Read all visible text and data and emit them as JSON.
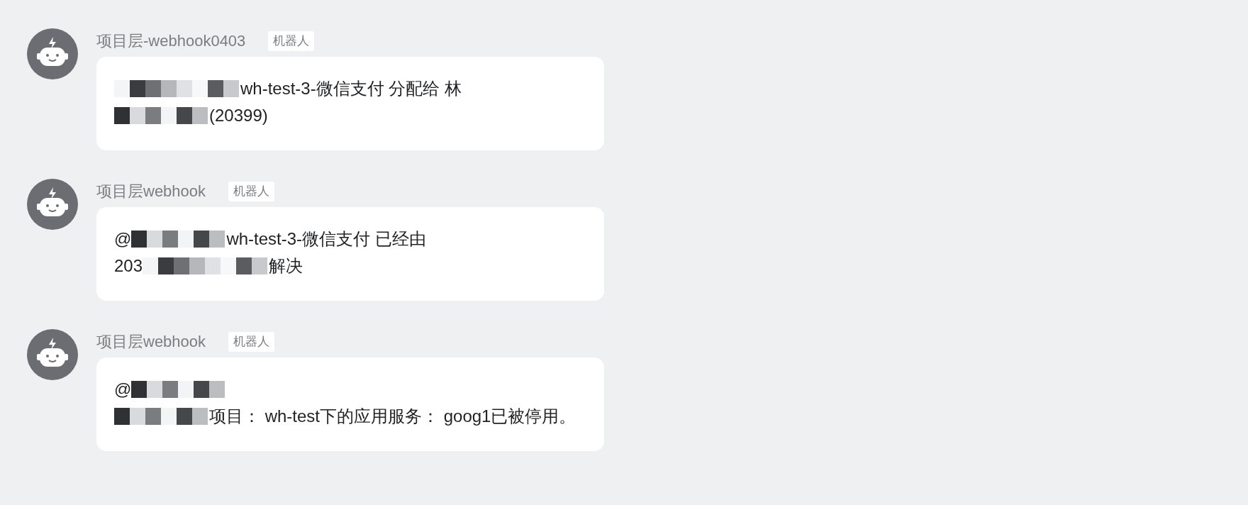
{
  "messages": [
    {
      "sender": "项目层-webhook0403",
      "badge": "机器人",
      "lines": [
        [
          {
            "kind": "redacted"
          },
          {
            "kind": "text",
            "text": "wh-test-3-微信支付 分配给 林"
          }
        ],
        [
          {
            "kind": "redacted"
          },
          {
            "kind": "text",
            "text": "(20399)"
          }
        ]
      ]
    },
    {
      "sender": "项目层webhook",
      "badge": "机器人",
      "lines": [
        [
          {
            "kind": "text",
            "text": "@"
          },
          {
            "kind": "redacted"
          },
          {
            "kind": "text",
            "text": "wh-test-3-微信支付 已经由"
          }
        ],
        [
          {
            "kind": "text",
            "text": "203"
          },
          {
            "kind": "redacted"
          },
          {
            "kind": "text",
            "text": "解决"
          }
        ]
      ]
    },
    {
      "sender": "项目层webhook",
      "badge": "机器人",
      "lines": [
        [
          {
            "kind": "text",
            "text": "@"
          },
          {
            "kind": "redacted"
          }
        ],
        [
          {
            "kind": "redacted"
          },
          {
            "kind": "text",
            "text": "项目： wh-test下的应用服务： goog1已被停用。"
          }
        ]
      ]
    }
  ]
}
